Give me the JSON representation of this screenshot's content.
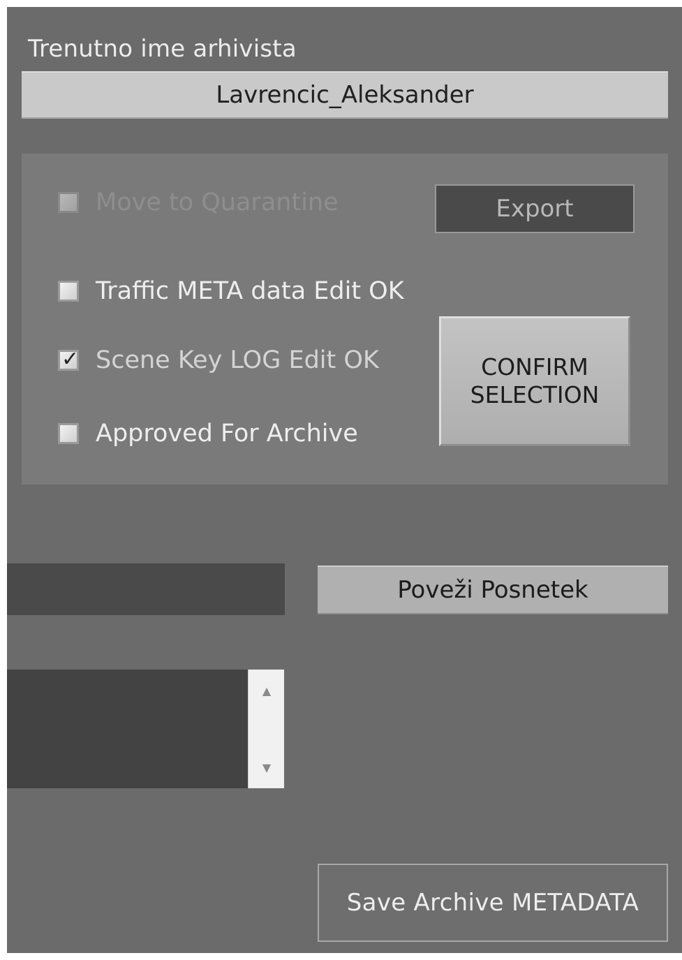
{
  "archivist": {
    "label": "Trenutno ime arhivista",
    "name": "Lavrencic_Aleksander"
  },
  "panel": {
    "checkboxes": [
      {
        "label": "Move to Quarantine",
        "checked": false,
        "enabled": false
      },
      {
        "label": "Traffic META data Edit OK",
        "checked": false,
        "enabled": true
      },
      {
        "label": "Scene Key LOG Edit OK",
        "checked": true,
        "enabled": true
      },
      {
        "label": "Approved For Archive",
        "checked": false,
        "enabled": true
      }
    ],
    "export_label": "Export",
    "confirm_label": "CONFIRM\nSELECTION"
  },
  "link": {
    "input_value": "",
    "button_label": "Poveži Posnetek"
  },
  "list": {
    "items": [],
    "scroll_up_icon": "▲",
    "scroll_down_icon": "▼"
  },
  "footer": {
    "save_label": "Save Archive METADATA"
  }
}
